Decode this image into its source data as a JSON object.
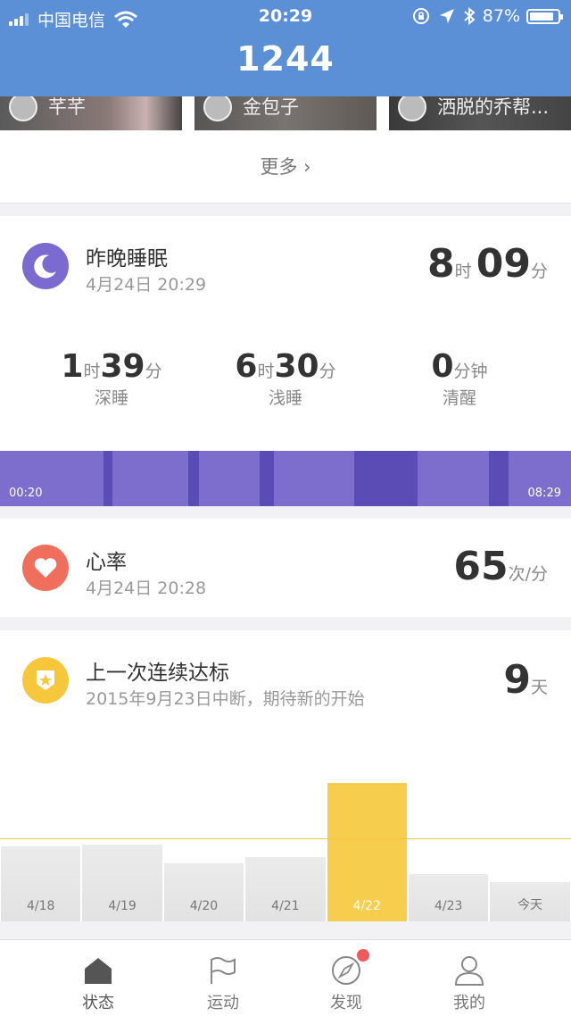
{
  "status_bar": {
    "carrier": "中国电信",
    "time": "20:29",
    "battery": "87%",
    "battery_level": 0.87
  },
  "header": {
    "title": "1244"
  },
  "friends": [
    {
      "name": "芊芊"
    },
    {
      "name": "金包子"
    },
    {
      "name": "洒脱的乔帮..."
    }
  ],
  "more": {
    "label": "更多 ›"
  },
  "sleep": {
    "title": "昨晚睡眠",
    "date": "4月24日 20:29",
    "total": {
      "hours": "8",
      "hour_unit": "时",
      "minutes": "09",
      "minute_unit": "分"
    },
    "stats": [
      {
        "parts": [
          {
            "n": "1",
            "u": "时"
          },
          {
            "n": "39",
            "u": "分"
          }
        ],
        "label": "深睡"
      },
      {
        "parts": [
          {
            "n": "6",
            "u": "时"
          },
          {
            "n": "30",
            "u": "分"
          }
        ],
        "label": "浅睡"
      },
      {
        "parts": [
          {
            "n": "0",
            "u": "分钟"
          }
        ],
        "label": "清醒"
      }
    ],
    "start": "00:20",
    "end": "08:29",
    "colors": {
      "light": "#7d6dcc",
      "deep": "#5a4bb5",
      "icon": "#7b6ad0"
    }
  },
  "heart": {
    "title": "心率",
    "date": "4月24日 20:28",
    "value": "65",
    "unit": "次/分",
    "icon_color": "#ef6f5c"
  },
  "streak": {
    "title": "上一次连续达标",
    "subtitle": "2015年9月23日中断，期待新的开始",
    "value": "9",
    "unit": "天",
    "icon_color": "#f6c63b"
  },
  "chart_data": {
    "type": "bar",
    "categories": [
      "4/18",
      "4/19",
      "4/20",
      "4/21",
      "4/22",
      "4/23",
      "今天"
    ],
    "values": [
      0.36,
      0.37,
      0.28,
      0.31,
      0.67,
      0.23,
      0.19
    ],
    "goal": 0.4,
    "highlight_index": 4,
    "colors": {
      "normal": "#e6e6e6",
      "highlight": "#f6cd4c",
      "goal": "#f5c840"
    }
  },
  "tabs": [
    {
      "label": "状态",
      "icon": "home-icon",
      "active": true
    },
    {
      "label": "运动",
      "icon": "flag-icon",
      "active": false
    },
    {
      "label": "发现",
      "icon": "compass-icon",
      "active": false,
      "badge": true
    },
    {
      "label": "我的",
      "icon": "person-icon",
      "active": false
    }
  ]
}
